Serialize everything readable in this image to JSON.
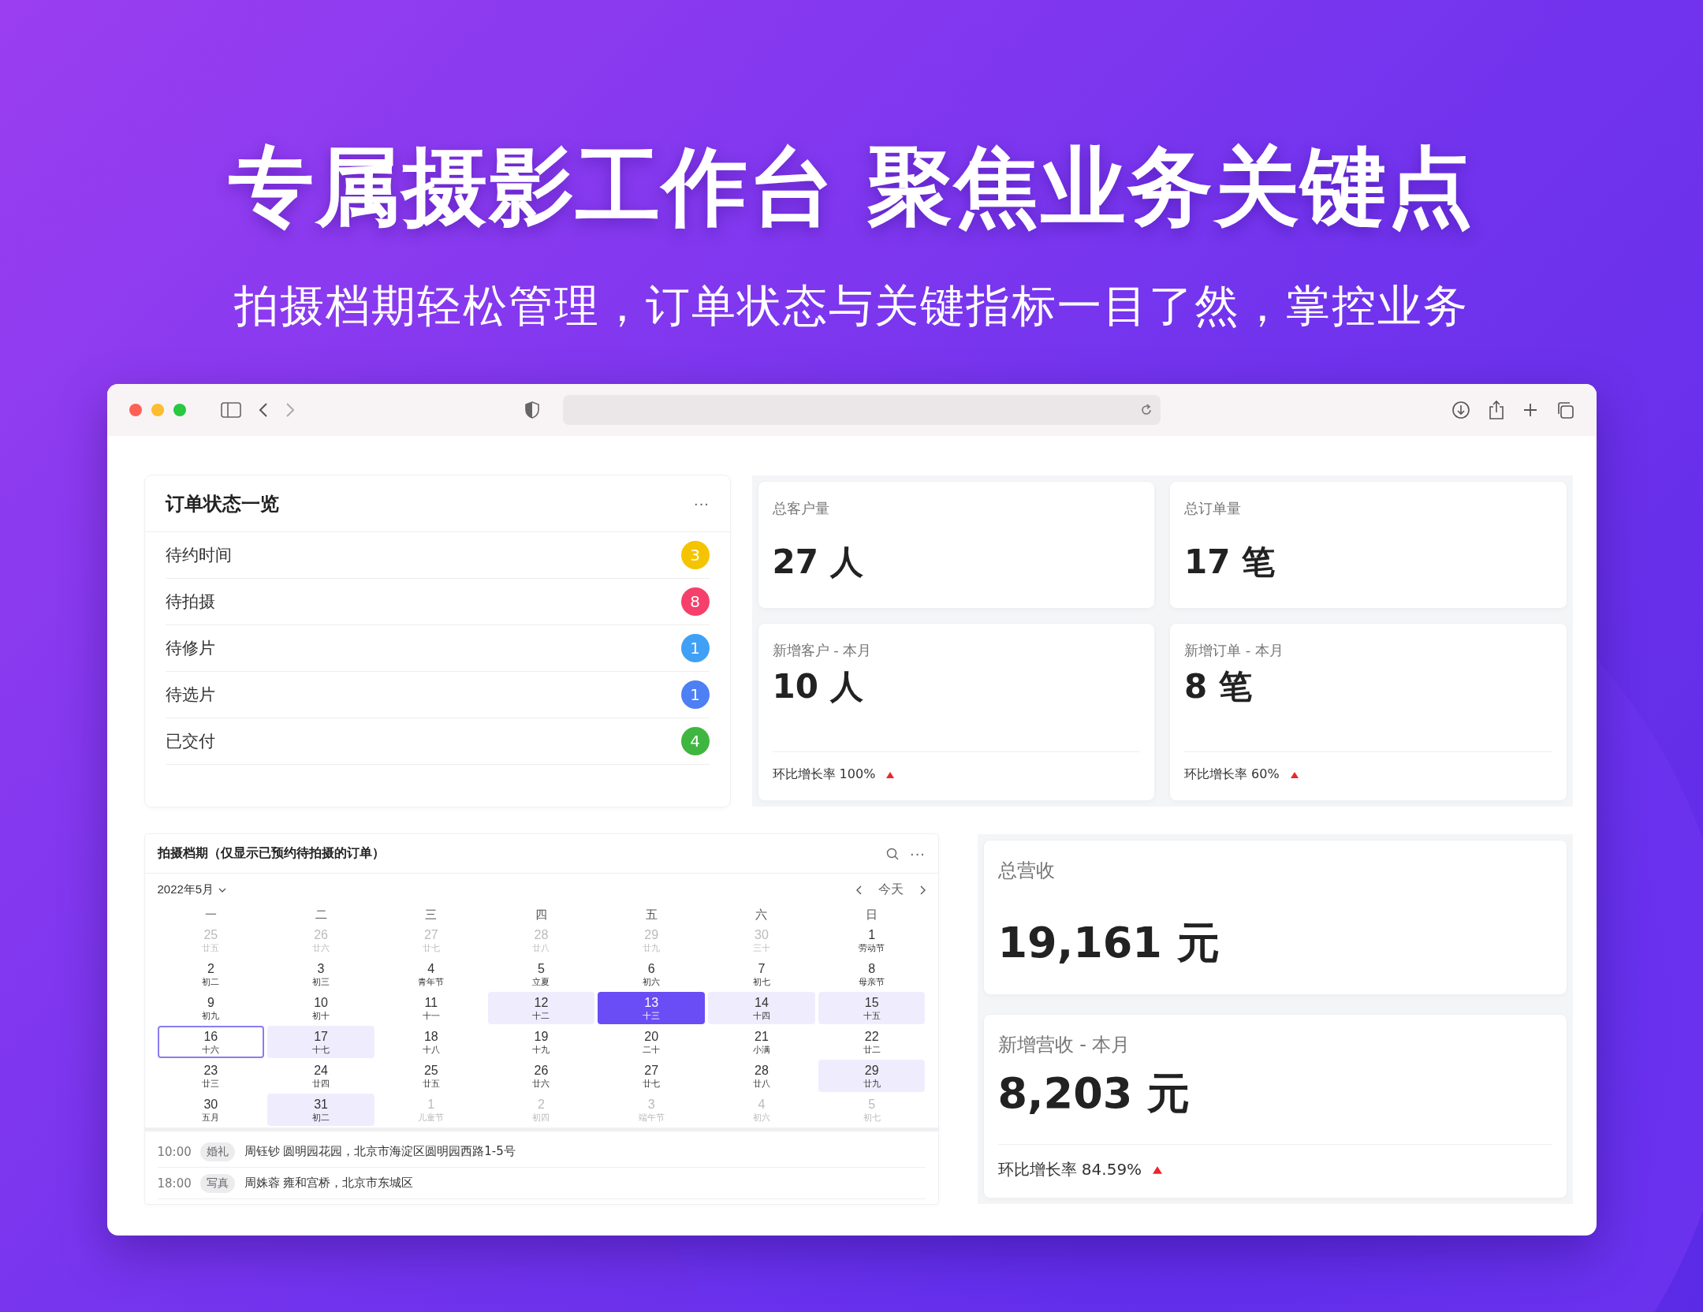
{
  "headline": "专属摄影工作台 聚焦业务关键点",
  "subheadline": "拍摄档期轻松管理，订单状态与关键指标一目了然，掌控业务",
  "order_status": {
    "title": "订单状态一览",
    "menu": "···",
    "items": [
      {
        "label": "待约时间",
        "count": "3",
        "color": "#f5c400"
      },
      {
        "label": "待拍摄",
        "count": "8",
        "color": "#f5406b"
      },
      {
        "label": "待修片",
        "count": "1",
        "color": "#3fa0f5"
      },
      {
        "label": "待选片",
        "count": "1",
        "color": "#4d7ff5"
      },
      {
        "label": "已交付",
        "count": "4",
        "color": "#3fb63f"
      }
    ]
  },
  "stats": [
    {
      "label": "总客户量",
      "value": "27 人"
    },
    {
      "label": "总订单量",
      "value": "17 笔"
    },
    {
      "label": "新增客户 - 本月",
      "value": "10 人",
      "growth": "环比增长率 100%"
    },
    {
      "label": "新增订单 - 本月",
      "value": "8 笔",
      "growth": "环比增长率 60%"
    }
  ],
  "schedule": {
    "title": "拍摄档期（仅显示已预约待拍摄的订单）",
    "month": "2022年5月",
    "today_button": "今天",
    "weekdays": [
      "一",
      "二",
      "三",
      "四",
      "五",
      "六",
      "日"
    ],
    "days": [
      {
        "day": "25",
        "lunar": "廿五",
        "outside": true,
        "booked": false,
        "today": false,
        "selected": false
      },
      {
        "day": "26",
        "lunar": "廿六",
        "outside": true,
        "booked": false,
        "today": false,
        "selected": false
      },
      {
        "day": "27",
        "lunar": "廿七",
        "outside": true,
        "booked": false,
        "today": false,
        "selected": false
      },
      {
        "day": "28",
        "lunar": "廿八",
        "outside": true,
        "booked": false,
        "today": false,
        "selected": false
      },
      {
        "day": "29",
        "lunar": "廿九",
        "outside": true,
        "booked": false,
        "today": false,
        "selected": false
      },
      {
        "day": "30",
        "lunar": "三十",
        "outside": true,
        "booked": false,
        "today": false,
        "selected": false
      },
      {
        "day": "1",
        "lunar": "劳动节",
        "outside": false,
        "booked": false,
        "today": false,
        "selected": false
      },
      {
        "day": "2",
        "lunar": "初二",
        "outside": false,
        "booked": false,
        "today": false,
        "selected": false
      },
      {
        "day": "3",
        "lunar": "初三",
        "outside": false,
        "booked": false,
        "today": false,
        "selected": false
      },
      {
        "day": "4",
        "lunar": "青年节",
        "outside": false,
        "booked": false,
        "today": false,
        "selected": false
      },
      {
        "day": "5",
        "lunar": "立夏",
        "outside": false,
        "booked": false,
        "today": false,
        "selected": false
      },
      {
        "day": "6",
        "lunar": "初六",
        "outside": false,
        "booked": false,
        "today": false,
        "selected": false
      },
      {
        "day": "7",
        "lunar": "初七",
        "outside": false,
        "booked": false,
        "today": false,
        "selected": false
      },
      {
        "day": "8",
        "lunar": "母亲节",
        "outside": false,
        "booked": false,
        "today": false,
        "selected": false
      },
      {
        "day": "9",
        "lunar": "初九",
        "outside": false,
        "booked": false,
        "today": false,
        "selected": false
      },
      {
        "day": "10",
        "lunar": "初十",
        "outside": false,
        "booked": false,
        "today": false,
        "selected": false
      },
      {
        "day": "11",
        "lunar": "十一",
        "outside": false,
        "booked": false,
        "today": false,
        "selected": false
      },
      {
        "day": "12",
        "lunar": "十二",
        "outside": false,
        "booked": true,
        "today": false,
        "selected": false
      },
      {
        "day": "13",
        "lunar": "十三",
        "outside": false,
        "booked": true,
        "today": false,
        "selected": true
      },
      {
        "day": "14",
        "lunar": "十四",
        "outside": false,
        "booked": true,
        "today": false,
        "selected": false
      },
      {
        "day": "15",
        "lunar": "十五",
        "outside": false,
        "booked": true,
        "today": false,
        "selected": false
      },
      {
        "day": "16",
        "lunar": "十六",
        "outside": false,
        "booked": false,
        "today": true,
        "selected": false
      },
      {
        "day": "17",
        "lunar": "十七",
        "outside": false,
        "booked": true,
        "today": false,
        "selected": false
      },
      {
        "day": "18",
        "lunar": "十八",
        "outside": false,
        "booked": false,
        "today": false,
        "selected": false
      },
      {
        "day": "19",
        "lunar": "十九",
        "outside": false,
        "booked": false,
        "today": false,
        "selected": false
      },
      {
        "day": "20",
        "lunar": "二十",
        "outside": false,
        "booked": false,
        "today": false,
        "selected": false
      },
      {
        "day": "21",
        "lunar": "小满",
        "outside": false,
        "booked": false,
        "today": false,
        "selected": false
      },
      {
        "day": "22",
        "lunar": "廿二",
        "outside": false,
        "booked": false,
        "today": false,
        "selected": false
      },
      {
        "day": "23",
        "lunar": "廿三",
        "outside": false,
        "booked": false,
        "today": false,
        "selected": false
      },
      {
        "day": "24",
        "lunar": "廿四",
        "outside": false,
        "booked": false,
        "today": false,
        "selected": false
      },
      {
        "day": "25",
        "lunar": "廿五",
        "outside": false,
        "booked": false,
        "today": false,
        "selected": false
      },
      {
        "day": "26",
        "lunar": "廿六",
        "outside": false,
        "booked": false,
        "today": false,
        "selected": false
      },
      {
        "day": "27",
        "lunar": "廿七",
        "outside": false,
        "booked": false,
        "today": false,
        "selected": false
      },
      {
        "day": "28",
        "lunar": "廿八",
        "outside": false,
        "booked": false,
        "today": false,
        "selected": false
      },
      {
        "day": "29",
        "lunar": "廿九",
        "outside": false,
        "booked": true,
        "today": false,
        "selected": false
      },
      {
        "day": "30",
        "lunar": "五月",
        "outside": false,
        "booked": false,
        "today": false,
        "selected": false
      },
      {
        "day": "31",
        "lunar": "初二",
        "outside": false,
        "booked": true,
        "today": false,
        "selected": false
      },
      {
        "day": "1",
        "lunar": "儿童节",
        "outside": true,
        "booked": false,
        "today": false,
        "selected": false
      },
      {
        "day": "2",
        "lunar": "初四",
        "outside": true,
        "booked": false,
        "today": false,
        "selected": false
      },
      {
        "day": "3",
        "lunar": "端午节",
        "outside": true,
        "booked": false,
        "today": false,
        "selected": false
      },
      {
        "day": "4",
        "lunar": "初六",
        "outside": true,
        "booked": false,
        "today": false,
        "selected": false
      },
      {
        "day": "5",
        "lunar": "初七",
        "outside": true,
        "booked": false,
        "today": false,
        "selected": false
      }
    ],
    "events": [
      {
        "time": "10:00",
        "tag": "婚礼",
        "text": "周钰钞 圆明园花园，北京市海淀区圆明园西路1-5号"
      },
      {
        "time": "18:00",
        "tag": "写真",
        "text": "周姝蓉 雍和宫桥，北京市东城区"
      }
    ]
  },
  "revenue": [
    {
      "label": "总营收",
      "value": "19,161 元"
    },
    {
      "label": "新增营收 - 本月",
      "value": "8,203 元",
      "growth": "环比增长率 84.59%"
    }
  ]
}
